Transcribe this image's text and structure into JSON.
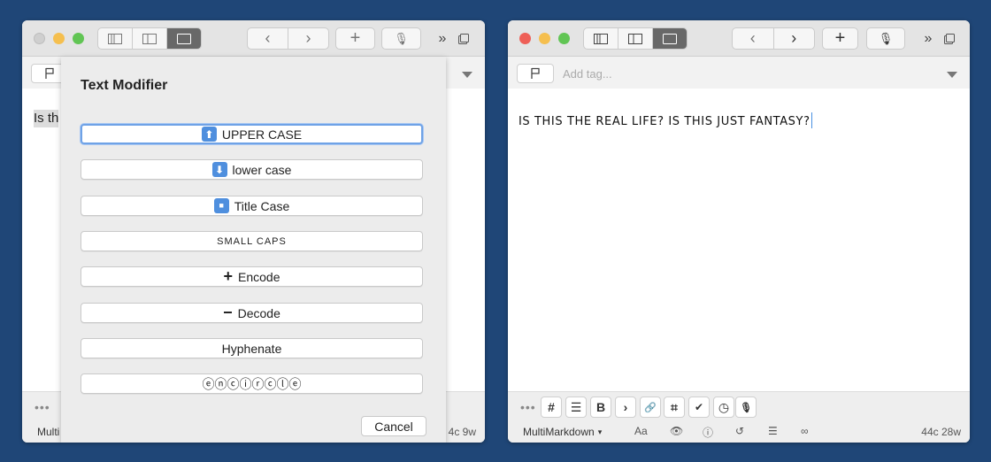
{
  "left_window": {
    "editor_text": "Is th",
    "status_mode": "Multi",
    "status_count": "4c 9w",
    "dialog": {
      "title": "Text Modifier",
      "buttons": [
        {
          "icon": "⬆",
          "label": "UPPER CASE"
        },
        {
          "icon": "⬇",
          "label": "lower case"
        },
        {
          "icon": "■",
          "label": "Title Case"
        },
        {
          "icon": "",
          "label": "SMALL CAPS"
        },
        {
          "icon": "+",
          "label": "Encode"
        },
        {
          "icon": "−",
          "label": "Decode"
        },
        {
          "icon": "",
          "label": "Hyphenate"
        },
        {
          "icon": "",
          "label": "ⓔⓝⓒⓘⓡⓒⓛⓔ"
        }
      ],
      "cancel_label": "Cancel"
    }
  },
  "right_window": {
    "tag_placeholder": "Add tag...",
    "editor_text": "IS THIS THE REAL LIFE? IS THIS JUST FANTASY?",
    "status_mode": "MultiMarkdown",
    "status_font": "Aa",
    "status_count": "44c 28w",
    "toolbar": [
      "#",
      "☰",
      "B",
      "›",
      "🔗",
      "⌗",
      "✔",
      "◷",
      "🎙"
    ]
  },
  "colors": {
    "background": "#1f4677",
    "focus_ring": "#6fa2e6",
    "emoji_blue": "#4f8fde"
  }
}
